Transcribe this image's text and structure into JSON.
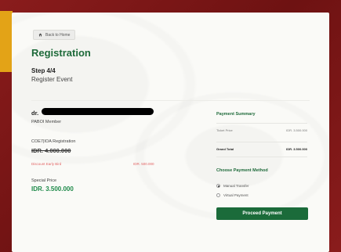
{
  "nav": {
    "back_label": "Back to Home"
  },
  "header": {
    "title": "Registration",
    "step": "Step 4/4",
    "step_subtitle": "Register Event"
  },
  "member": {
    "name_prefix": "dr.",
    "type": "PABOI Member"
  },
  "registration": {
    "label": "COE7|IOA Registration",
    "original_price": "IDR. 4.000.000",
    "discount_label": "Discount Early Bird",
    "discount_value": "IDR. 500.000",
    "special_label": "Special Price",
    "special_price": "IDR. 3.500.000"
  },
  "summary": {
    "title": "Payment Summary",
    "ticket_label": "Ticket Price",
    "ticket_value": "IDR. 3.500.000",
    "grand_label": "Grand Total",
    "grand_value": "IDR. 3.500.000"
  },
  "payment": {
    "title": "Choose Payment Method",
    "options": [
      "Manual Transfer",
      "Virtual Payment"
    ],
    "selected": "Manual Transfer",
    "proceed_label": "Proceed Payment"
  },
  "colors": {
    "brand_green": "#1e6a3a",
    "button_green": "#1b6b3a",
    "discount_red": "#e26464",
    "background_maroon": "#7a1616",
    "accent_gold": "#e3a317"
  }
}
